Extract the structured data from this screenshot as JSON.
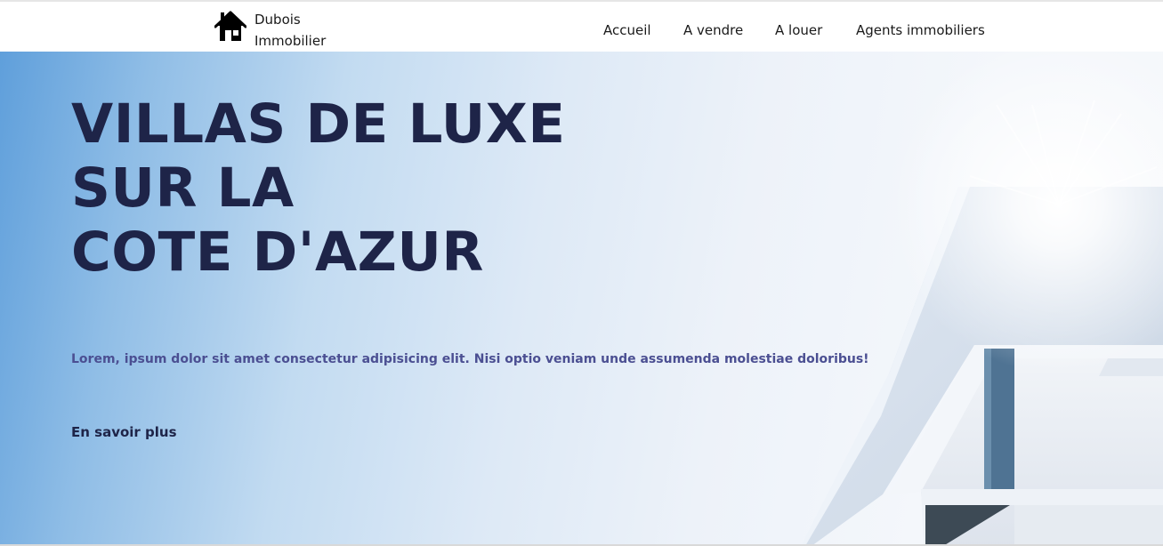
{
  "brand": {
    "line1": "Dubois",
    "line2": "Immobilier",
    "icon": "house-icon"
  },
  "nav": {
    "items": [
      {
        "label": "Accueil"
      },
      {
        "label": "A vendre"
      },
      {
        "label": "A louer"
      },
      {
        "label": "Agents immobiliers"
      }
    ]
  },
  "hero": {
    "title_lines": [
      "VILLAS DE LUXE",
      "SUR LA",
      "COTE D'AZUR"
    ],
    "text": "Lorem, ipsum dolor sit amet consectetur adipisicing elit. Nisi optio veniam unde assumenda molestiae doloribus!",
    "cta_label": "En savoir plus"
  },
  "colors": {
    "title": "#1e2448",
    "text": "#4b4f92",
    "sky": "#5f9fdb"
  }
}
